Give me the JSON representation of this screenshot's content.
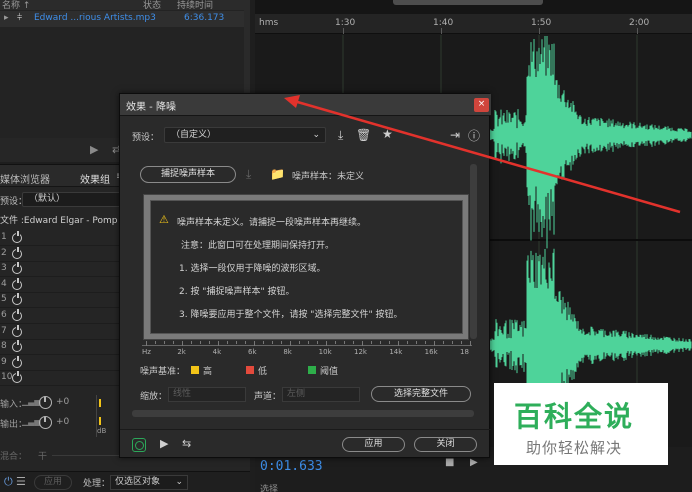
{
  "files_panel": {
    "col_name": "名称 ↑",
    "col_status": "状态",
    "col_duration": "持续时间",
    "file_name": "Edward ...rious Artists.mp3",
    "file_duration": "6:36.173"
  },
  "rack": {
    "tab_media": "媒体浏览器",
    "tab_effects": "效果组",
    "tab_more": "≡",
    "preset_label": "预设：",
    "preset_value": "（默认）",
    "file_line": "文件 :Edward Elgar - Pomp and",
    "slots": [
      "1",
      "2",
      "3",
      "4",
      "5",
      "6",
      "7",
      "8",
      "9",
      "10"
    ],
    "input_label": "输入：",
    "output_label": "输出：",
    "input_gain": "+0",
    "output_gain": "+0",
    "db_label": "dB",
    "mix_label": "混合：",
    "mix_sub": "干",
    "apply_label": "应用",
    "process_label": "处理：",
    "process_value": "仅选区对象"
  },
  "editor": {
    "ruler_unit": "hms",
    "ruler_labels": [
      "1:30",
      "1:40",
      "1:50",
      "2:00"
    ],
    "time_display": "0:01.633",
    "selection_label": "选择"
  },
  "dialog": {
    "title": "效果 - 降噪",
    "close_glyph": "×",
    "preset_label": "预设：",
    "preset_value": "（自定义）",
    "capture_button": "捕捉噪声样本",
    "noise_sample_status": "噪声样本：未定义",
    "warning_text": "噪声样本未定义。请捕捉一段噪声样本再继续。",
    "note_text": "注意：此窗口可在处理期间保持打开。",
    "step1": "1. 选择一段仅用于降噪的波形区域。",
    "step2": "2. 按 \"捕捉噪声样本\" 按钮。",
    "step3": "3. 降噪要应用于整个文件，请按 \"选择完整文件\" 按钮。",
    "freq_labels": [
      "Hz",
      "2k",
      "4k",
      "6k",
      "8k",
      "10k",
      "12k",
      "14k",
      "16k",
      "18"
    ],
    "noise_baseline_label": "噪声基准：",
    "legend_high": "高",
    "legend_low": "低",
    "legend_threshold": "阈值",
    "legend_colors": {
      "high": "#f2c418",
      "low": "#e34a3c",
      "threshold": "#2eae4a"
    },
    "scale_label": "缩放：",
    "scale_value": "线性",
    "channel_label": "声道：",
    "channel_value": "左侧",
    "select_file_button": "选择完整文件",
    "apply_button": "应用",
    "close_button": "关闭"
  },
  "watermark": {
    "title": "百科全说",
    "subtitle": "助你轻松解决",
    "title_color": "#2eae5a"
  },
  "colors": {
    "waveform": "#4ed39a",
    "accent_blue": "#3d8ee8",
    "annotation_arrow": "#e2322c"
  }
}
